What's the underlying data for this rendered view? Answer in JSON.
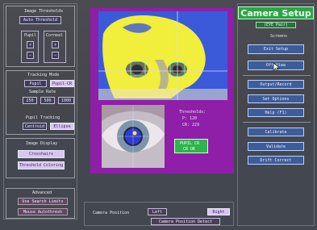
{
  "left": {
    "thresholds": {
      "heading": "Image Thresholds",
      "auto_threshold": "Auto Threshold",
      "pupil_label": "Pupil",
      "corneal_label": "Corneal"
    },
    "tracking_mode": {
      "heading": "Tracking Mode",
      "pupil": "Pupil",
      "pupil_cr": "Pupil-CR"
    },
    "sample_rate": {
      "heading": "Sample Rate",
      "options": [
        "250",
        "500",
        "1000"
      ]
    },
    "pupil_tracking": {
      "heading": "Pupil Tracking",
      "centroid": "Centroid",
      "ellipse": "Ellipse"
    },
    "image_display": {
      "heading": "Image Display",
      "crosshairs": "Crosshairs",
      "threshold_coloring": "Threshold Coloring"
    },
    "advanced": {
      "heading": "Advanced",
      "use_search_limits": "Use Search Limits",
      "mouse_autothresh": "Mouse Autothresh"
    }
  },
  "center": {
    "threshold_readout": {
      "label": "Thresholds:",
      "p_line": "P:  120",
      "cr_line": "CR: 229"
    },
    "status": {
      "line1": "PUPIL  CR",
      "line2": "CR  OK"
    },
    "camera_position": {
      "label": "Camera Position",
      "left": "Left",
      "right": "Right",
      "detect": "Camera Position Detect"
    }
  },
  "right": {
    "title": "Camera Setup",
    "subtitle": "(EYE Pair)",
    "screens_heading": "Screens",
    "exit_setup": "Exit Setup",
    "off_view": "Off View",
    "output_record": "Output/Record",
    "set_options": "Set Options",
    "help": "Help (F1)",
    "calibrate": "Calibrate",
    "validate": "Validate",
    "drift_correct": "Drift Correct"
  },
  "colors": {
    "accent_title": "#3bd451",
    "camera_bg": "#8f1ea8",
    "threshold_yellow": "#f0f03c",
    "threshold_blue": "#3656d8",
    "button_pink": "#d7c7ec"
  }
}
